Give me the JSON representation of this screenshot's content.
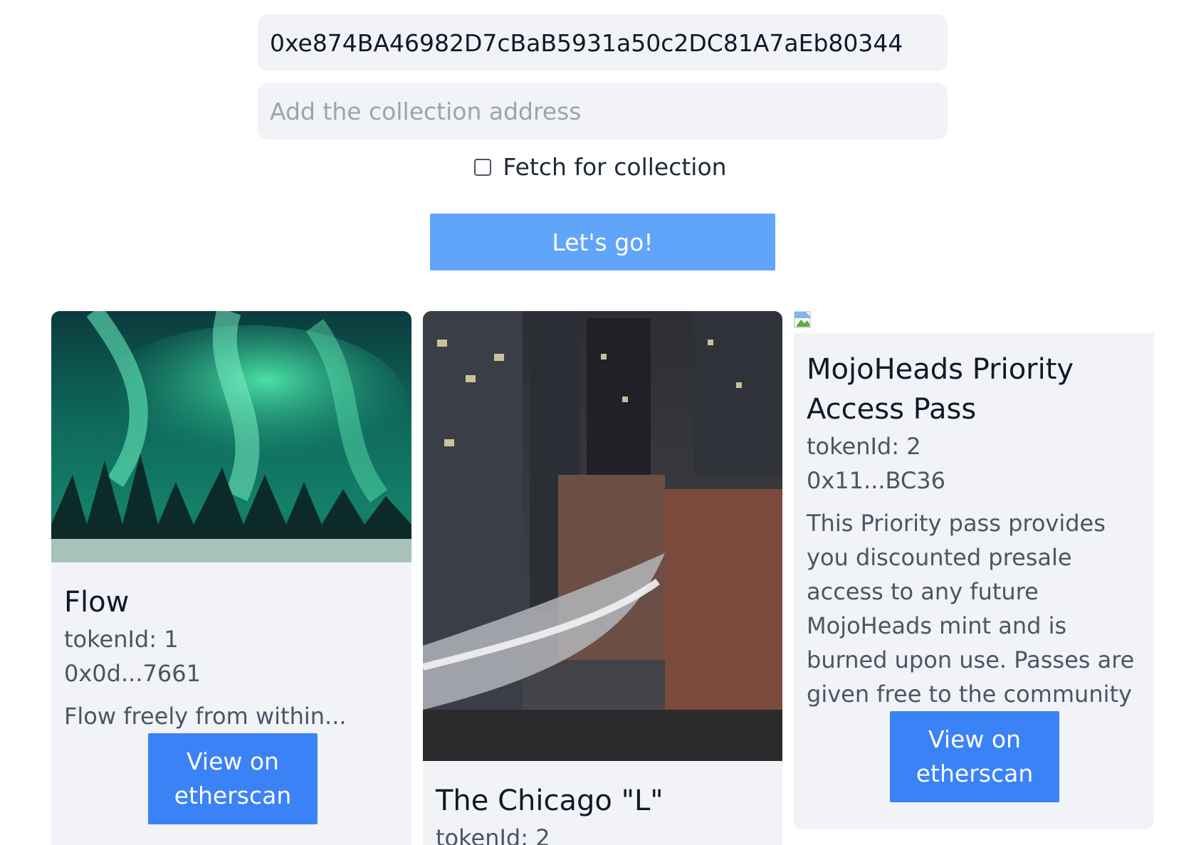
{
  "form": {
    "wallet_address": "0xe874BA46982D7cBaB5931a50c2DC81A7aEb80344",
    "collection_placeholder": "Add the collection address",
    "fetch_label": "Fetch for collection",
    "fetch_checked": false,
    "submit_label": "Let's go!"
  },
  "cards": [
    {
      "title": "Flow",
      "token": "tokenId: 1",
      "address": "0x0d...7661",
      "description": "Flow freely from within...",
      "button_label": "View on etherscan"
    },
    {
      "title": "The Chicago \"L\"",
      "token": "tokenId: 2"
    },
    {
      "title": "MojoHeads Priority Access Pass",
      "token": "tokenId: 2",
      "address": "0x11...BC36",
      "description": "This Priority pass provides you discounted presale access to any future MojoHeads mint and is burned upon use. Passes are given free to the community",
      "button_label": "View on etherscan"
    }
  ],
  "colors": {
    "primary_button": "#3b82f6",
    "submit_button": "#60a5fa",
    "card_background": "#f1f3f7"
  },
  "icons": {
    "broken_image": "broken-image-icon"
  }
}
